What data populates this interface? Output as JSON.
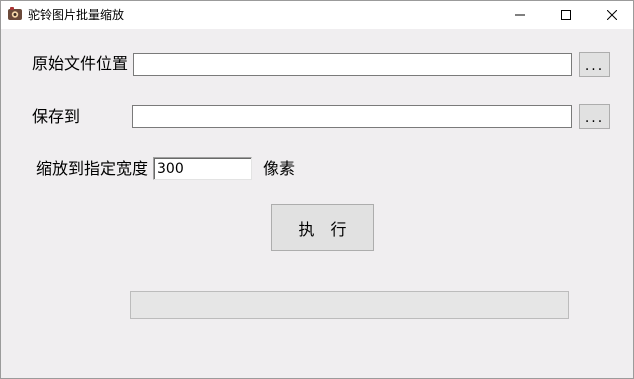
{
  "window": {
    "title": "驼铃图片批量缩放",
    "icon": "app-icon",
    "controls": {
      "minimize": "minimize-icon",
      "maximize": "maximize-icon",
      "close": "close-icon"
    }
  },
  "form": {
    "source_label": "原始文件位置",
    "source_value": "",
    "save_label": "保存到",
    "save_value": "",
    "browse_label": "...",
    "width_label": "缩放到指定宽度",
    "width_value": "300",
    "unit_label": "像素",
    "execute_label": "执行"
  },
  "progress": {
    "fraction": 0
  }
}
